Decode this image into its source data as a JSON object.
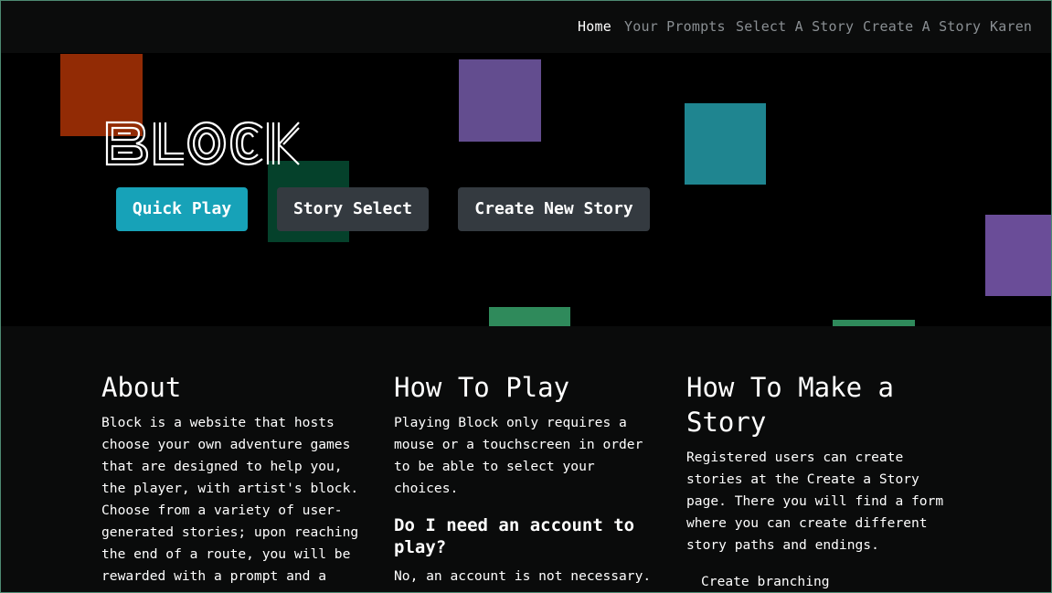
{
  "nav": {
    "items": [
      {
        "label": "Home",
        "active": true
      },
      {
        "label": "Your Prompts",
        "active": false
      },
      {
        "label": "Select A Story",
        "active": false
      },
      {
        "label": "Create A Story",
        "active": false
      },
      {
        "label": "Karen",
        "active": false
      }
    ]
  },
  "hero": {
    "brand": "BLOCK",
    "buttons": {
      "quick_play": "Quick Play",
      "story_select": "Story Select",
      "create_new_story": "Create New Story"
    },
    "square_colors": [
      "#922b05",
      "#634d8f",
      "#1f8590",
      "#05412b",
      "#6a4d98",
      "#2f8a5b",
      "#2f8a5b"
    ]
  },
  "about": {
    "title": "About",
    "text": "Block is a website that hosts\nchoose your own adventure games\nthat are designed to help you,\nthe player, with artist's block.\nChoose from a variety of user-\ngenerated stories; upon reaching\nthe end of a route, you will be\nrewarded with a prompt and a"
  },
  "how_to_play": {
    "title": "How To Play",
    "text": "Playing Block only requires a\nmouse or a touchscreen in order\nto be able to select your\nchoices.",
    "faq_title": "Do I need an account to\nplay?",
    "faq_text": "No, an account is not necessary."
  },
  "how_to_make": {
    "title": "How To Make a\nStory",
    "text": "Registered users can create\nstories at the Create a Story\npage. There you will find a form\nwhere you can create different\nstory paths and endings.",
    "list_item": "Create branching"
  },
  "colors": {
    "accent": "#17a2b8",
    "dark_button": "#343a40",
    "nav_inactive": "#8a8f93"
  }
}
